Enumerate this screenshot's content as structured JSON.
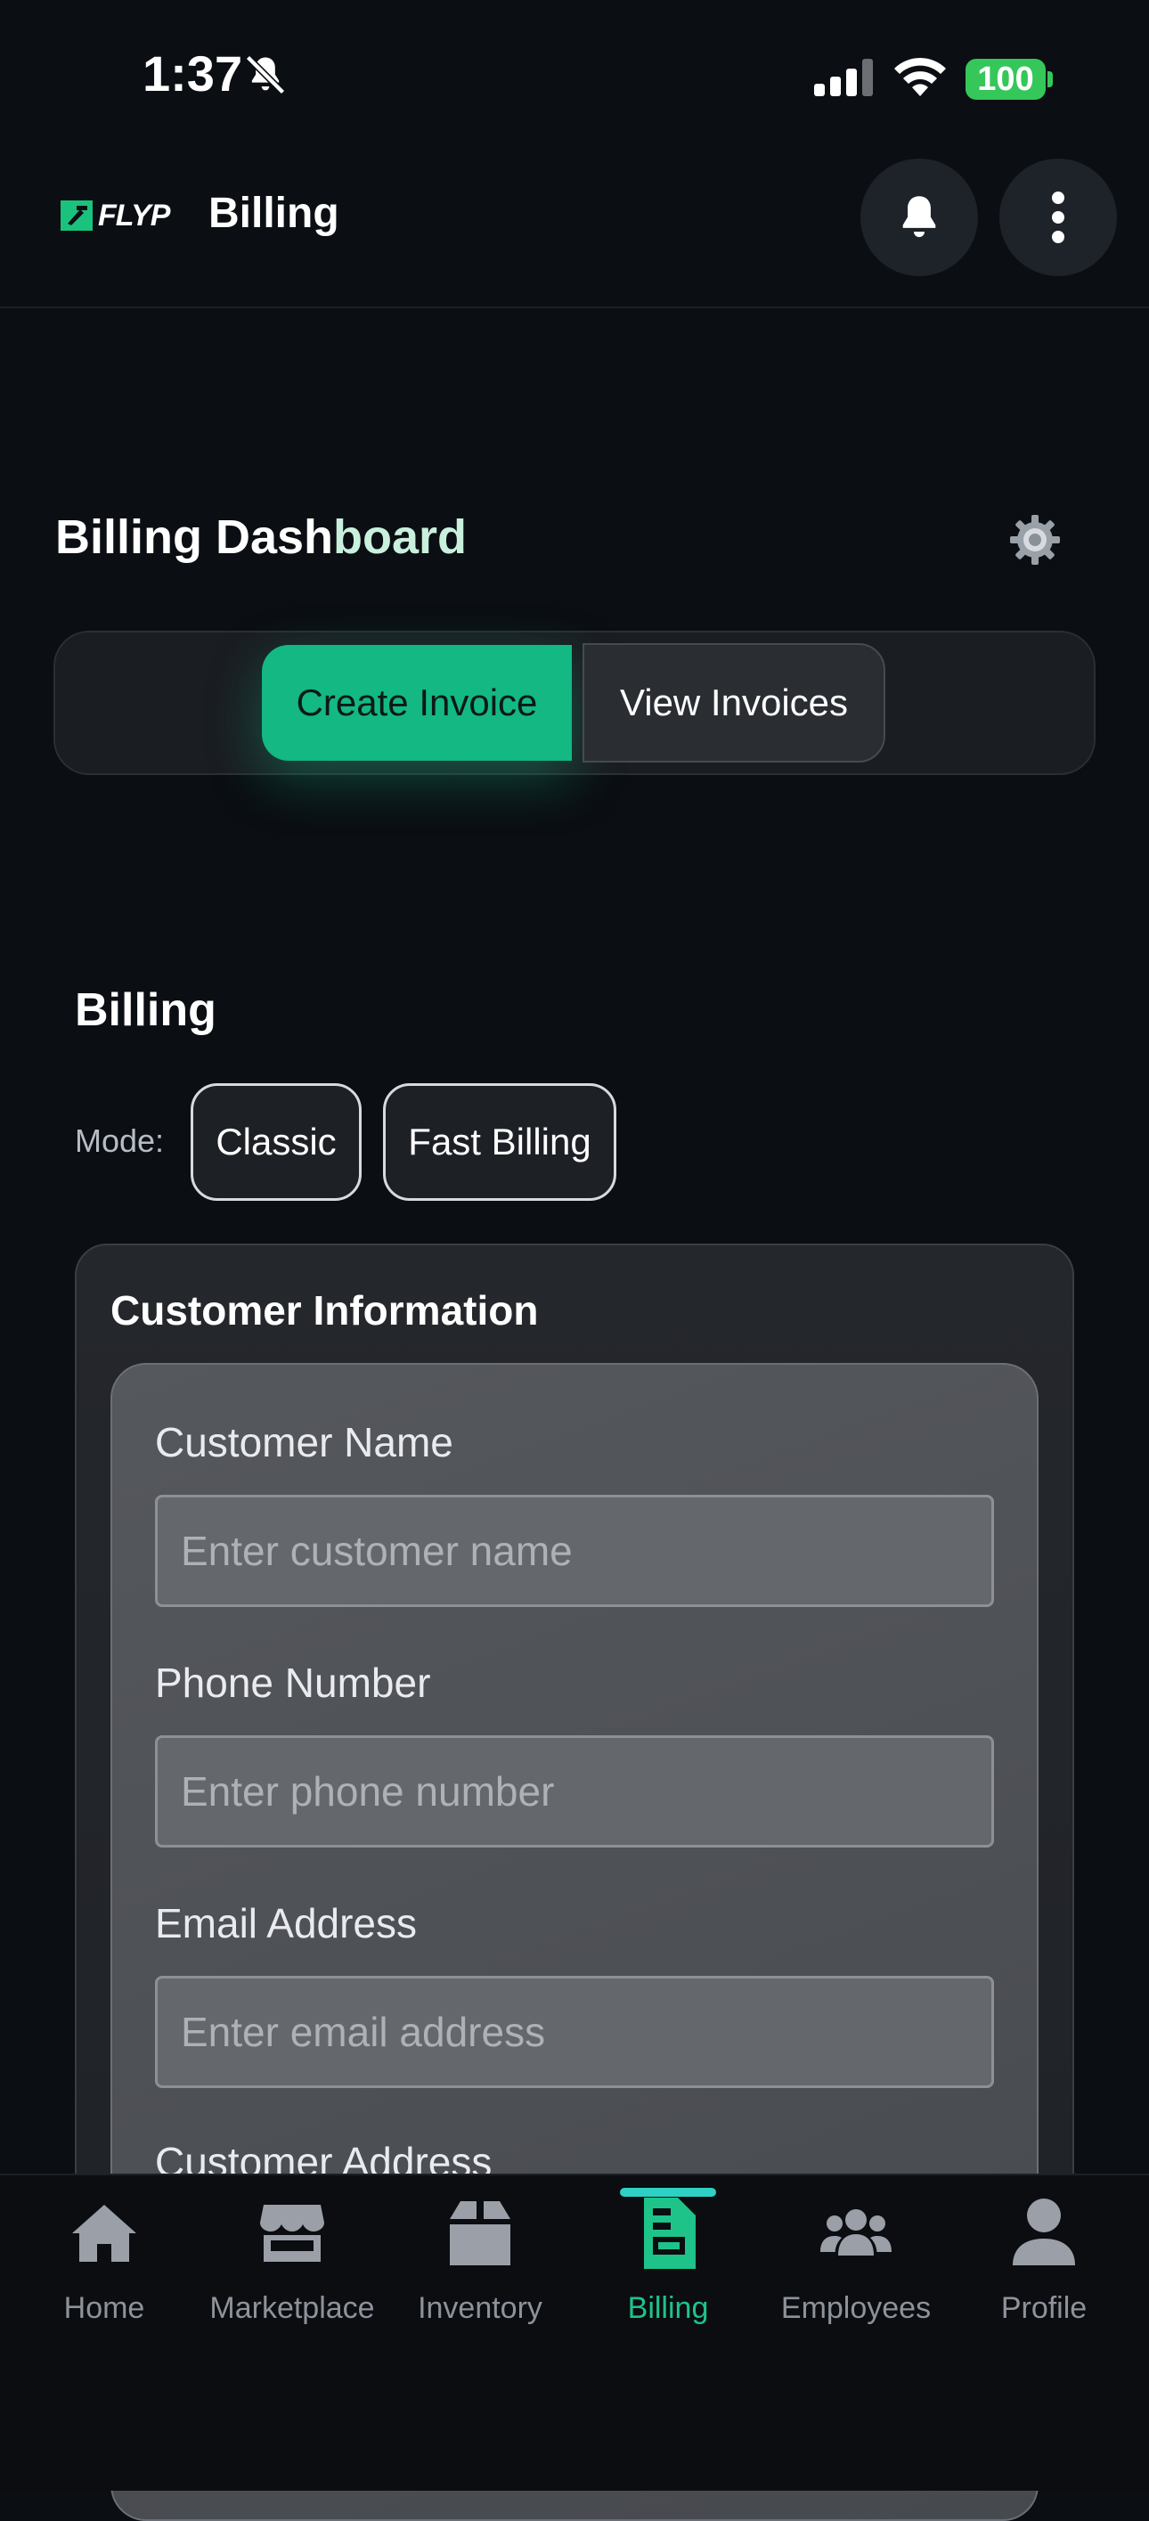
{
  "status_bar": {
    "time": "1:37",
    "battery": "100",
    "icons": [
      "bell-off-icon",
      "signal-icon",
      "wifi-icon",
      "battery-icon"
    ]
  },
  "header": {
    "logo_text": "FLYP",
    "title": "Billing",
    "icons": [
      "bell-icon",
      "more-vertical-icon"
    ]
  },
  "dashboard": {
    "title_main": "Billing Dash",
    "title_accent": "board",
    "settings_icon": "gear-icon",
    "tabs": [
      {
        "label": "Create Invoice",
        "active": true
      },
      {
        "label": "View Invoices",
        "active": false
      }
    ]
  },
  "billing": {
    "heading": "Billing",
    "mode_label": "Mode:",
    "modes": [
      "Classic",
      "Fast Billing"
    ]
  },
  "customer": {
    "title": "Customer Information",
    "fields": [
      {
        "label": "Customer Name",
        "placeholder": "Enter customer name",
        "value": ""
      },
      {
        "label": "Phone Number",
        "placeholder": "Enter phone number",
        "value": ""
      },
      {
        "label": "Email Address",
        "placeholder": "Enter email address",
        "value": ""
      },
      {
        "label": "Customer Address"
      }
    ]
  },
  "nav": {
    "items": [
      {
        "label": "Home",
        "icon": "home-icon"
      },
      {
        "label": "Marketplace",
        "icon": "store-icon"
      },
      {
        "label": "Inventory",
        "icon": "box-icon"
      },
      {
        "label": "Billing",
        "icon": "invoice-icon",
        "active": true
      },
      {
        "label": "Employees",
        "icon": "users-icon"
      },
      {
        "label": "Profile",
        "icon": "user-icon"
      }
    ]
  },
  "colors": {
    "accent": "#13b883",
    "background": "#0b0e13",
    "active_nav": "#1ec38a"
  }
}
